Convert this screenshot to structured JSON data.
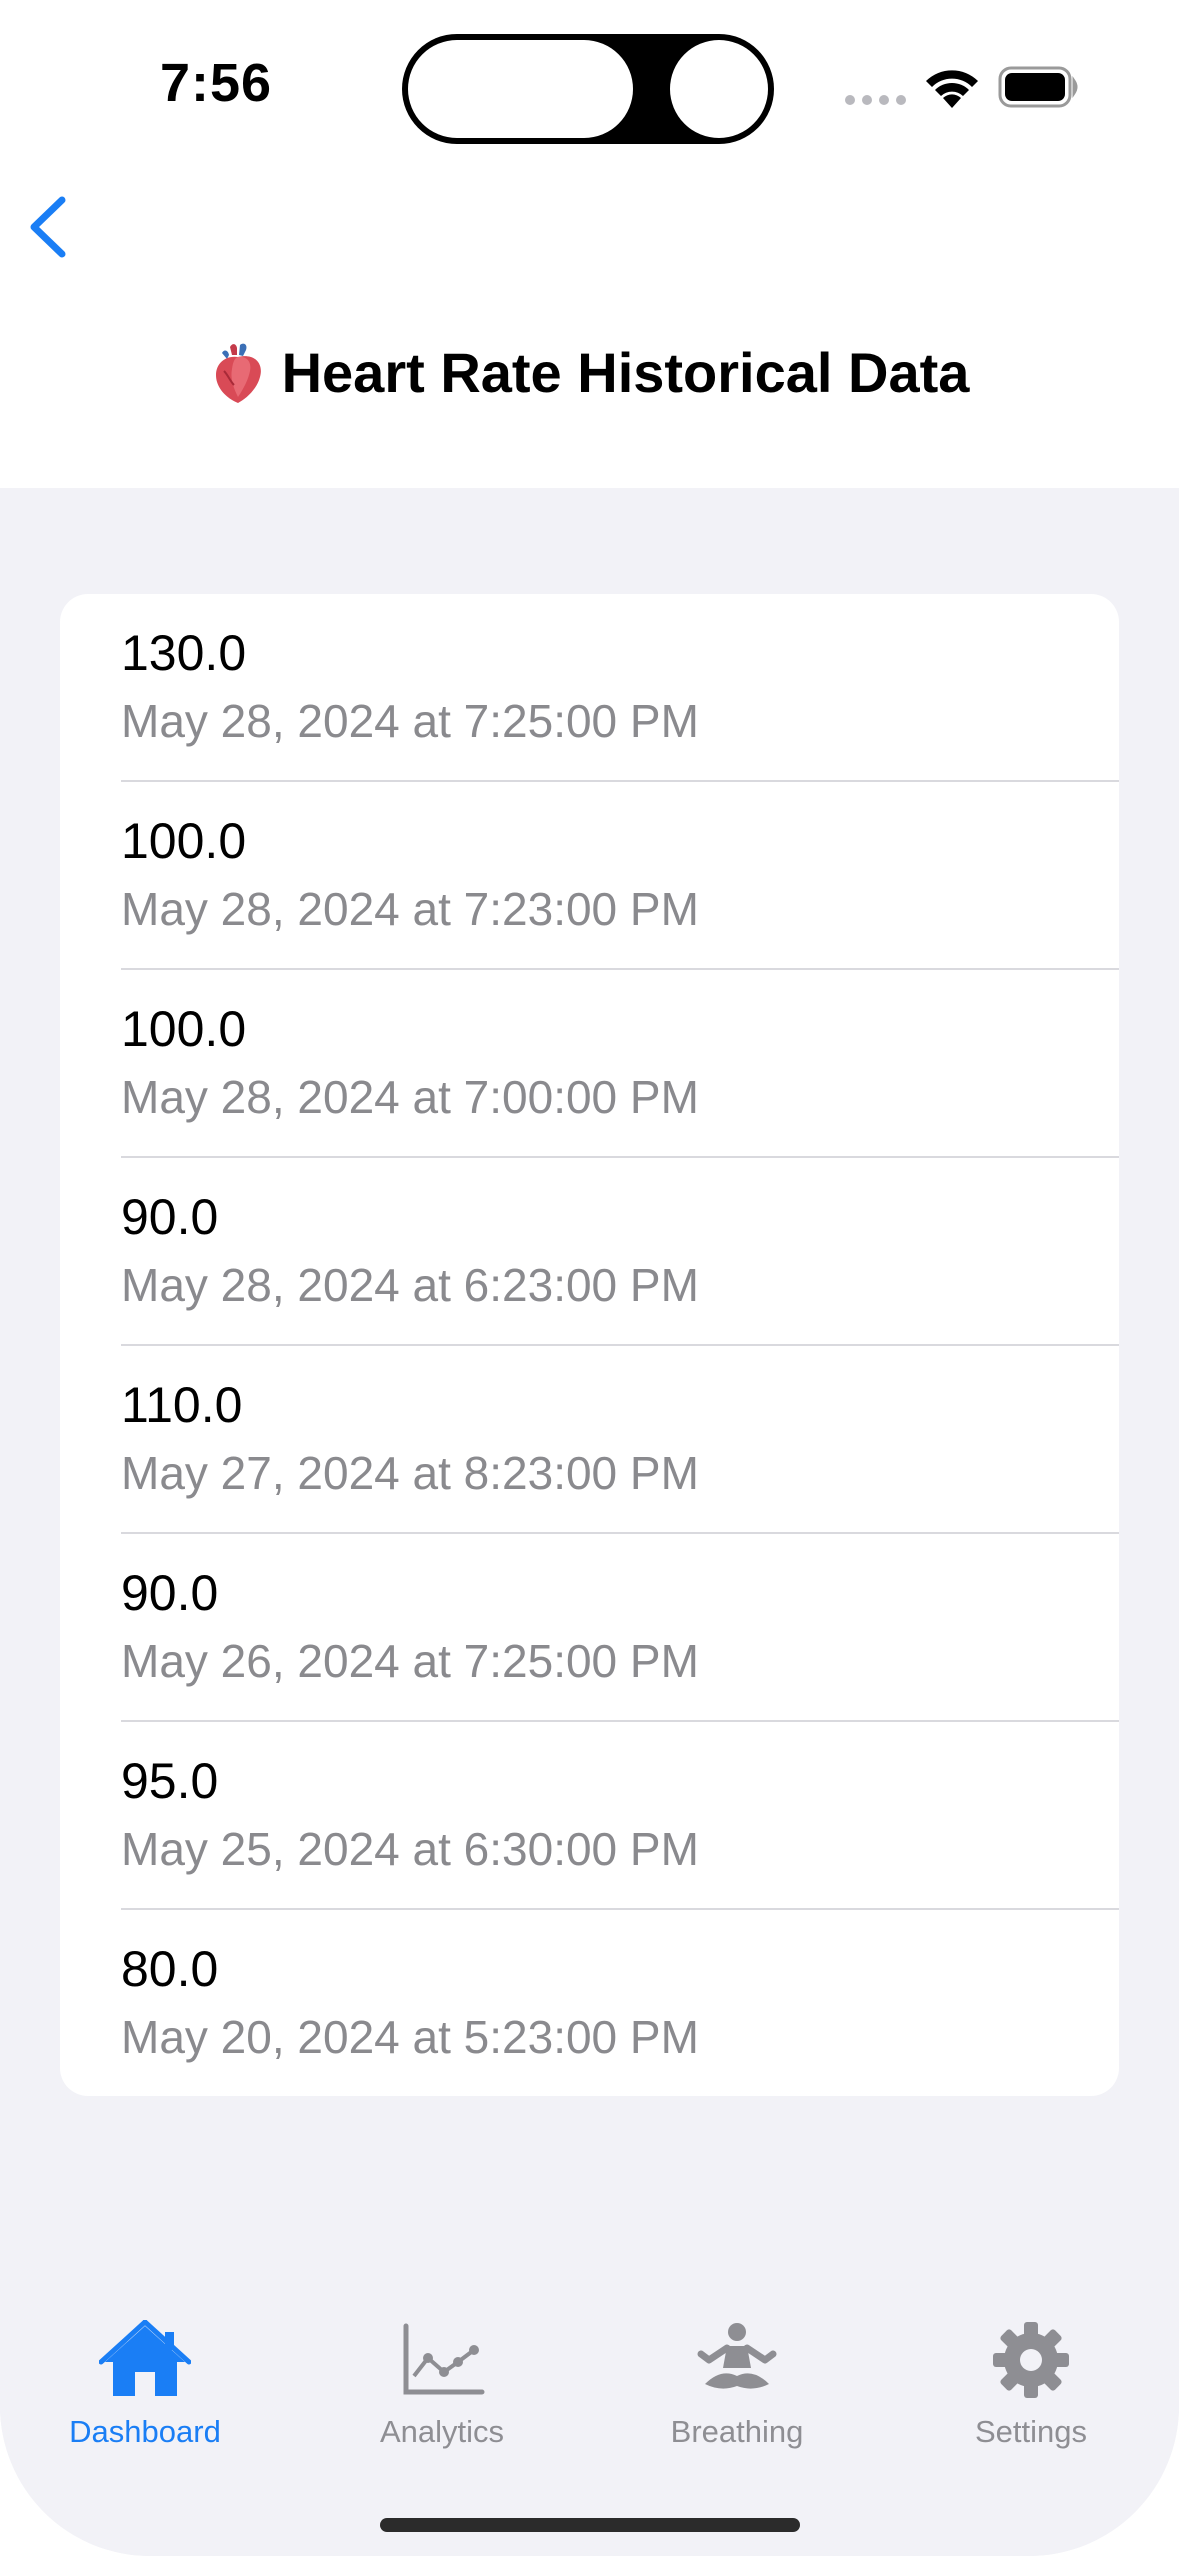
{
  "status_bar": {
    "time": "7:56"
  },
  "nav": {
    "back_icon": "chevron-left-icon",
    "title": "Heart Rate Historical Data",
    "title_icon": "anatomical-heart-icon"
  },
  "records": [
    {
      "value": "130.0",
      "date": "May 28, 2024 at 7:25:00 PM"
    },
    {
      "value": "100.0",
      "date": "May 28, 2024 at 7:23:00 PM"
    },
    {
      "value": "100.0",
      "date": "May 28, 2024 at 7:00:00 PM"
    },
    {
      "value": "90.0",
      "date": "May 28, 2024 at 6:23:00 PM"
    },
    {
      "value": "110.0",
      "date": "May 27, 2024 at 8:23:00 PM"
    },
    {
      "value": "90.0",
      "date": "May 26, 2024 at 7:25:00 PM"
    },
    {
      "value": "95.0",
      "date": "May 25, 2024 at 6:30:00 PM"
    },
    {
      "value": "80.0",
      "date": "May 20, 2024 at 5:23:00 PM"
    }
  ],
  "tab_bar": {
    "tabs": [
      {
        "label": "Dashboard",
        "icon": "house-icon",
        "active": true
      },
      {
        "label": "Analytics",
        "icon": "line-chart-icon",
        "active": false
      },
      {
        "label": "Breathing",
        "icon": "meditation-figure-icon",
        "active": false
      },
      {
        "label": "Settings",
        "icon": "gear-icon",
        "active": false
      }
    ]
  },
  "colors": {
    "accent": "#1a7ef5",
    "inactive": "#8e8e93",
    "background": "#f2f2f7"
  }
}
